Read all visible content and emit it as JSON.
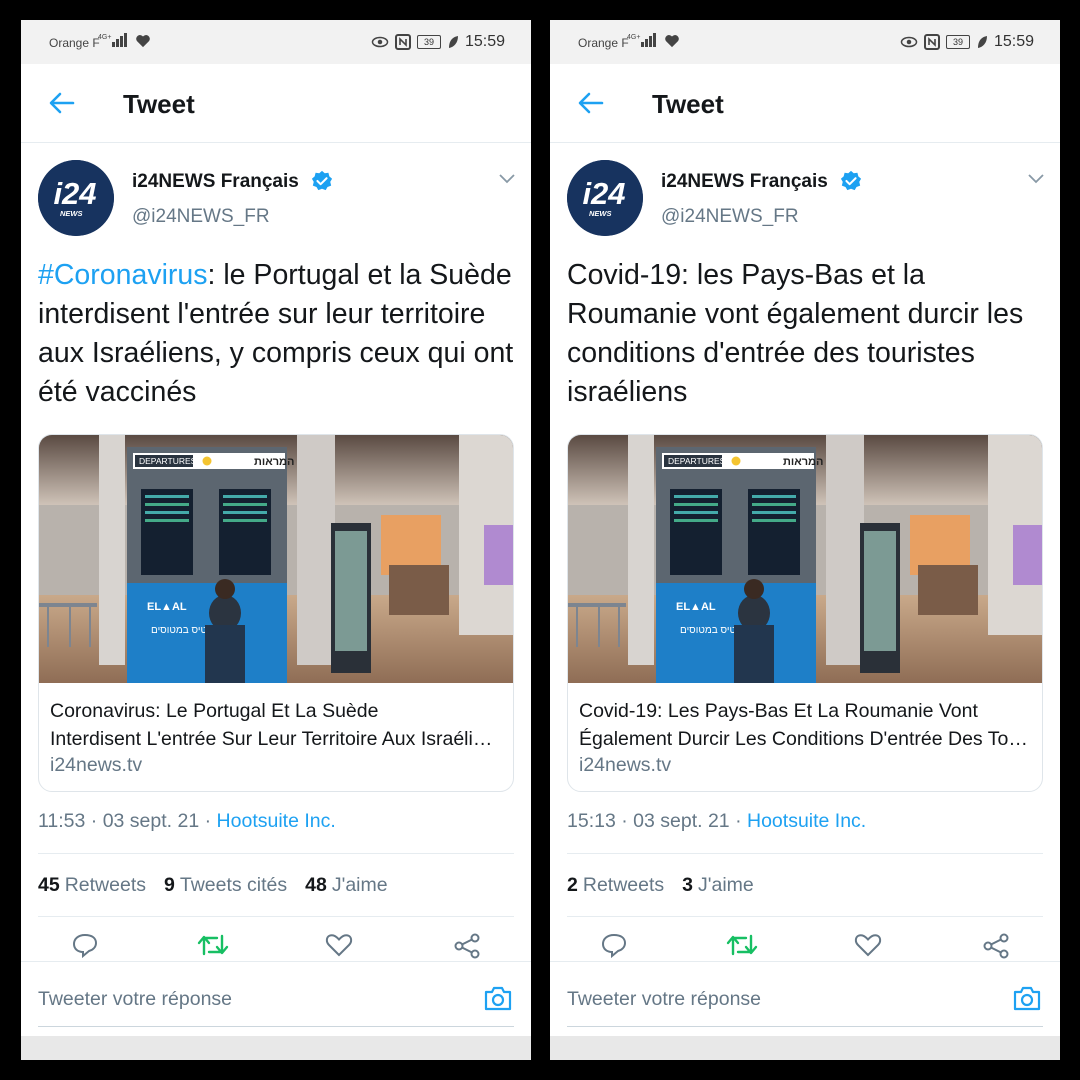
{
  "colors": {
    "accent": "#1da1f2",
    "retweet_green": "#17bf63",
    "text": "#14171a",
    "muted": "#657786"
  },
  "screens": [
    {
      "status": {
        "carrier": "Orange F",
        "network": "4G+",
        "battery": "39",
        "time": "15:59"
      },
      "header": {
        "title": "Tweet"
      },
      "author": {
        "name": "i24NEWS Français",
        "handle": "@i24NEWS_FR",
        "avatar_text": "i24",
        "avatar_sub": "NEWS"
      },
      "tweet": {
        "hashtag": "#Coronavirus",
        "text": ": le Portugal et la Suède interdisent l'entrée sur leur territoire aux Israéliens, y compris ceux qui ont été vaccinés"
      },
      "card": {
        "title_line1": "Coronavirus: Le Portugal Et La Suède",
        "title_line2": "Interdisent L'entrée Sur Leur Territoire Aux Israéliens",
        "domain": "i24news.tv",
        "sign_departures": "DEPARTURES",
        "sign_hebrew": "המראות",
        "ad_brand": "EL▲AL",
        "ad_text": "כורטיס במטוסים"
      },
      "meta": {
        "time": "11:53",
        "date": "03 sept. 21",
        "source": "Hootsuite Inc."
      },
      "stats": [
        {
          "count": "45",
          "label": "Retweets"
        },
        {
          "count": "9",
          "label": "Tweets cités"
        },
        {
          "count": "48",
          "label": "J'aime"
        }
      ],
      "reply": {
        "placeholder": "Tweeter votre réponse"
      }
    },
    {
      "status": {
        "carrier": "Orange F",
        "network": "4G+",
        "battery": "39",
        "time": "15:59"
      },
      "header": {
        "title": "Tweet"
      },
      "author": {
        "name": "i24NEWS Français",
        "handle": "@i24NEWS_FR",
        "avatar_text": "i24",
        "avatar_sub": "NEWS"
      },
      "tweet": {
        "hashtag": "",
        "text": "Covid-19: les Pays-Bas et la Roumanie vont également durcir les conditions d'entrée des touristes israéliens"
      },
      "card": {
        "title_line1": "Covid-19: Les Pays-Bas Et La Roumanie Vont",
        "title_line2": "Également Durcir Les Conditions D'entrée Des Touristes",
        "domain": "i24news.tv",
        "sign_departures": "DEPARTURES",
        "sign_hebrew": "המראות",
        "ad_brand": "EL▲AL",
        "ad_text": "כורטיס במטוסים"
      },
      "meta": {
        "time": "15:13",
        "date": "03 sept. 21",
        "source": "Hootsuite Inc."
      },
      "stats": [
        {
          "count": "2",
          "label": "Retweets"
        },
        {
          "count": "3",
          "label": "J'aime"
        }
      ],
      "reply": {
        "placeholder": "Tweeter votre réponse"
      }
    }
  ]
}
